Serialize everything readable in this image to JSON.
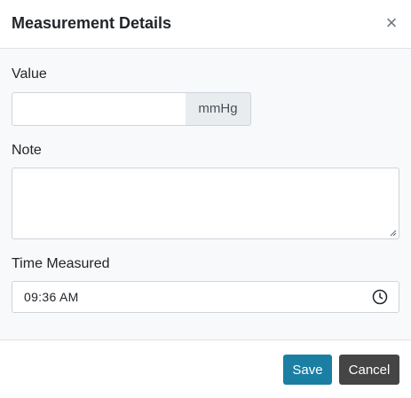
{
  "dialog": {
    "title": "Measurement Details",
    "close_glyph": "×",
    "close_icon": "close-icon"
  },
  "form": {
    "value_label": "Value",
    "value_input": "",
    "unit": "mmHg",
    "note_label": "Note",
    "note_value": "",
    "time_label": "Time Measured",
    "time_value": "09:36  AM",
    "time_icon": "clock-icon"
  },
  "footer": {
    "save_label": "Save",
    "cancel_label": "Cancel"
  },
  "colors": {
    "save_button": "#1a7fa3",
    "cancel_button": "#454545",
    "body_background": "#f8f9fa"
  }
}
